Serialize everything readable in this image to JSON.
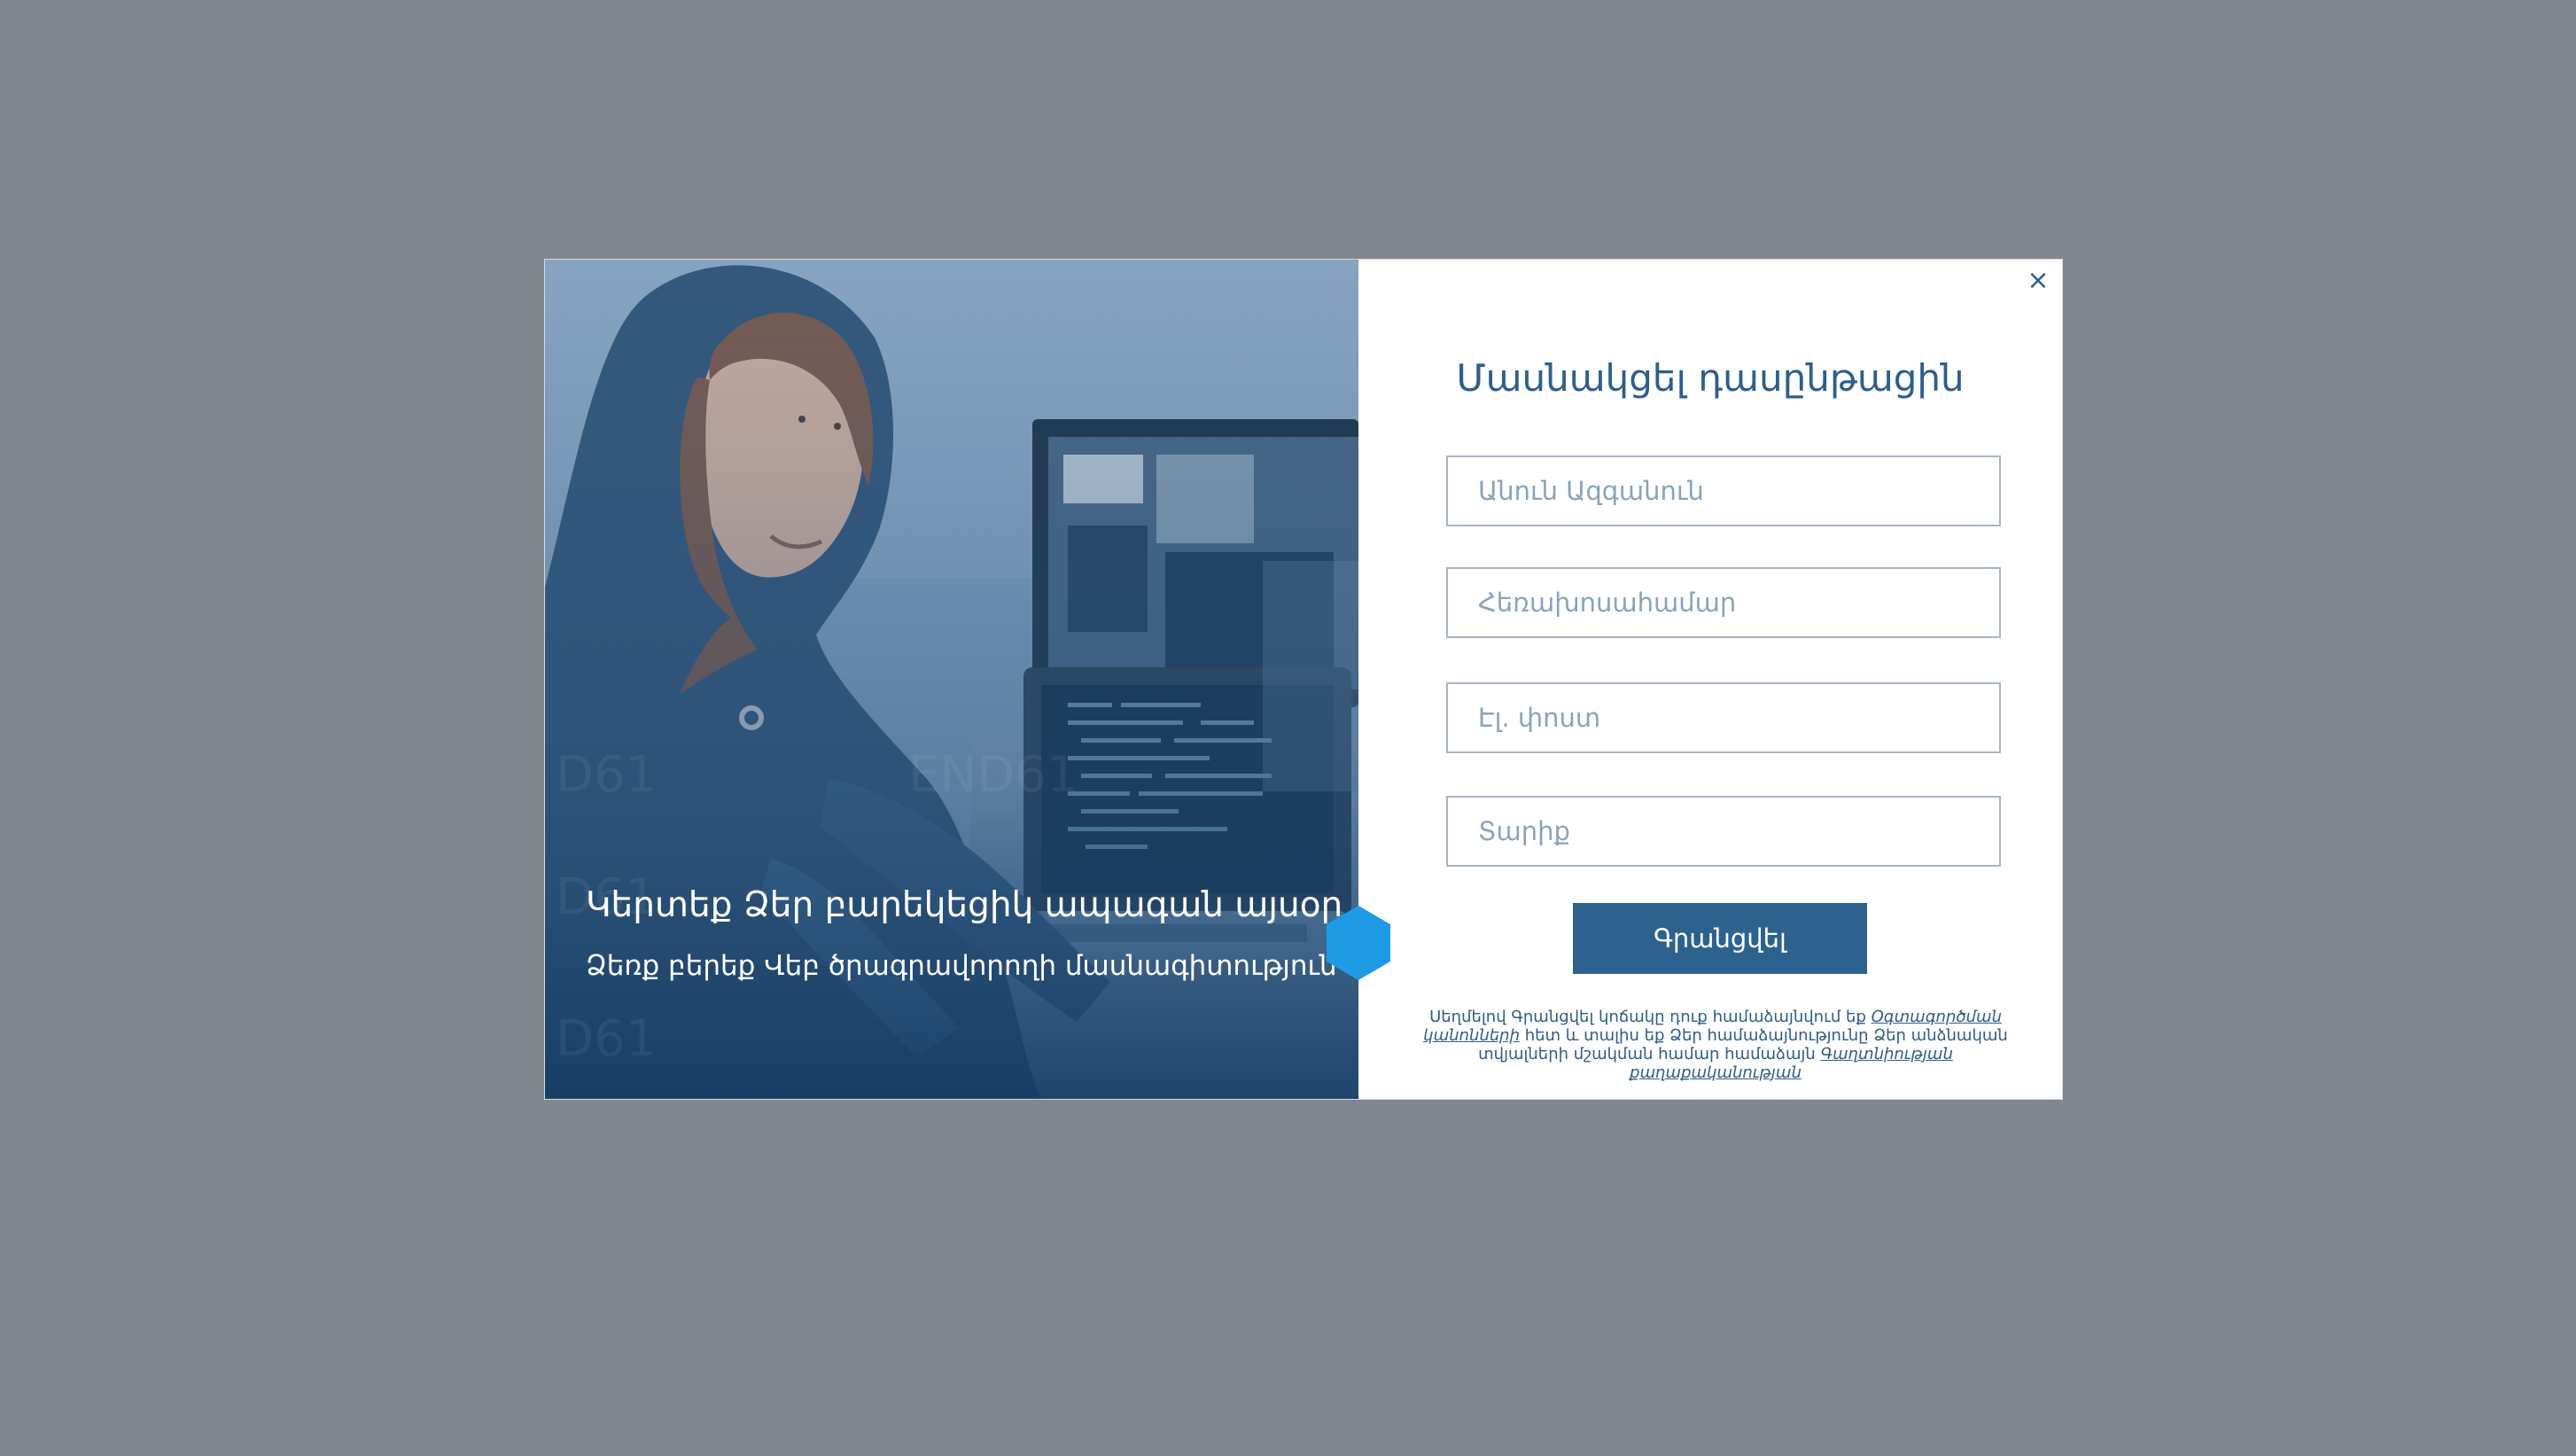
{
  "overlay": {
    "background_color": "#82868d"
  },
  "modal": {
    "close_icon": "×",
    "hero": {
      "title": "Կերտեք Ձեր բարեկեցիկ ապագան այսօր",
      "subtitle": "Ձեռք բերեք Վեբ ծրագրավորողի մասնագիտություն",
      "image_icon": "programmer-photo",
      "accent_color": "#1f9be6"
    },
    "form": {
      "title": "Մասնակցել դասընթացին",
      "fields": [
        {
          "name": "full-name-input",
          "placeholder": "Անուն Ազգանուն",
          "value": ""
        },
        {
          "name": "phone-input",
          "placeholder": "Հեռախոսահամար",
          "value": ""
        },
        {
          "name": "email-input",
          "placeholder": "Էլ. փոստ",
          "value": ""
        },
        {
          "name": "age-input",
          "placeholder": "Տարիք",
          "value": ""
        }
      ],
      "submit_label": "Գրանցվել",
      "legal": {
        "prefix": "Սեղմելով Գրանցվել կոճակը դուք համաձայնվում եք ",
        "terms_link": "Օգտագործման կանոնների",
        "middle": " հետ և տալիս եք Ձեր համաձայնությունը Ձեր անձնական տվյալների մշակման համար համաձայն ",
        "privacy_link": "Գաղտնիության քաղաքականության"
      }
    }
  }
}
